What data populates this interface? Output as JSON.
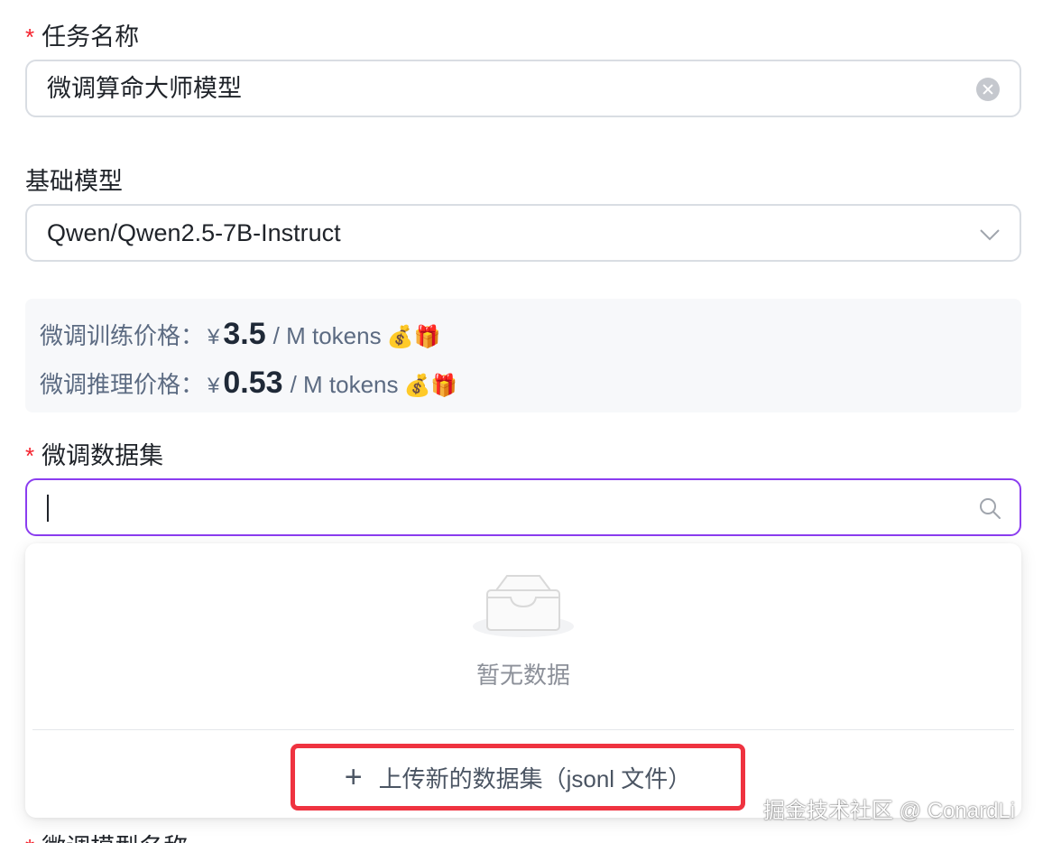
{
  "task_name": {
    "required_mark": "*",
    "label": "任务名称",
    "value": "微调算命大师模型"
  },
  "base_model": {
    "label": "基础模型",
    "value": "Qwen/Qwen2.5-7B-Instruct"
  },
  "pricing": {
    "training": {
      "label": "微调训练价格：",
      "currency": "¥",
      "amount": "3.5",
      "unit": "/ M tokens",
      "emoji": "💰🎁"
    },
    "inference": {
      "label": "微调推理价格：",
      "currency": "¥",
      "amount": "0.53",
      "unit": "/ M tokens",
      "emoji": "💰🎁"
    }
  },
  "dataset": {
    "required_mark": "*",
    "label": "微调数据集",
    "search_value": ""
  },
  "dropdown": {
    "empty_text": "暂无数据",
    "upload_label": "上传新的数据集（jsonl 文件）",
    "upload_icon": "plus-icon"
  },
  "next_field": {
    "required_mark": "*",
    "label": "微调模型名称"
  },
  "watermark": "掘金技术社区 @ ConardLi",
  "colors": {
    "accent_focus": "#8b3df0",
    "required": "#f5222d",
    "highlight_box": "#ef3340"
  }
}
